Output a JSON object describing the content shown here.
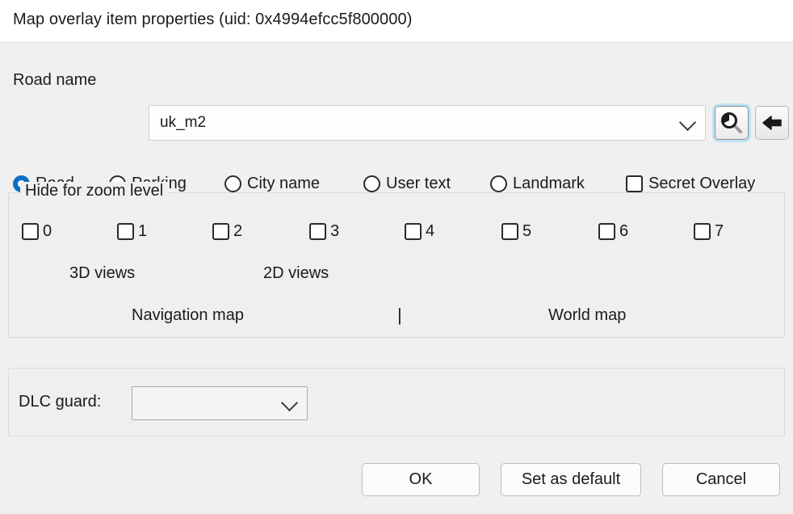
{
  "window": {
    "title": "Map overlay item properties (uid: 0x4994efcc5f800000)"
  },
  "road_name_row": {
    "label": "Road name",
    "combo_value": "uk_m2",
    "search_button_icon": "magnifier-icon",
    "back_button_icon": "left-arrow-icon"
  },
  "item_type": {
    "options": [
      {
        "label": "Road",
        "type": "radio",
        "checked": true
      },
      {
        "label": "Parking",
        "type": "radio",
        "checked": false
      },
      {
        "label": "City name",
        "type": "radio",
        "checked": false
      },
      {
        "label": "User text",
        "type": "radio",
        "checked": false
      },
      {
        "label": "Landmark",
        "type": "radio",
        "checked": false
      },
      {
        "label": "Secret Overlay",
        "type": "checkbox",
        "checked": false
      }
    ]
  },
  "hide_for_zoom_level": {
    "title": "Hide for zoom level",
    "levels": [
      {
        "label": "0",
        "checked": false
      },
      {
        "label": "1",
        "checked": false
      },
      {
        "label": "2",
        "checked": false
      },
      {
        "label": "3",
        "checked": false
      },
      {
        "label": "4",
        "checked": false
      },
      {
        "label": "5",
        "checked": false
      },
      {
        "label": "6",
        "checked": false
      },
      {
        "label": "7",
        "checked": false
      }
    ],
    "views_3d_label": "3D views",
    "views_2d_label": "2D views",
    "navigation_map_label": "Navigation map",
    "separator_label": "|",
    "world_map_label": "World map"
  },
  "dlc_guard": {
    "label": "DLC guard:",
    "value": ""
  },
  "footer": {
    "ok_label": "OK",
    "set_default_label": "Set as default",
    "cancel_label": "Cancel"
  },
  "colors": {
    "accent": "#0d6fc4",
    "focus_ring": "#bfe3f5",
    "dialog_background": "#f0f0f0",
    "titlebar_background": "#ffffff"
  }
}
